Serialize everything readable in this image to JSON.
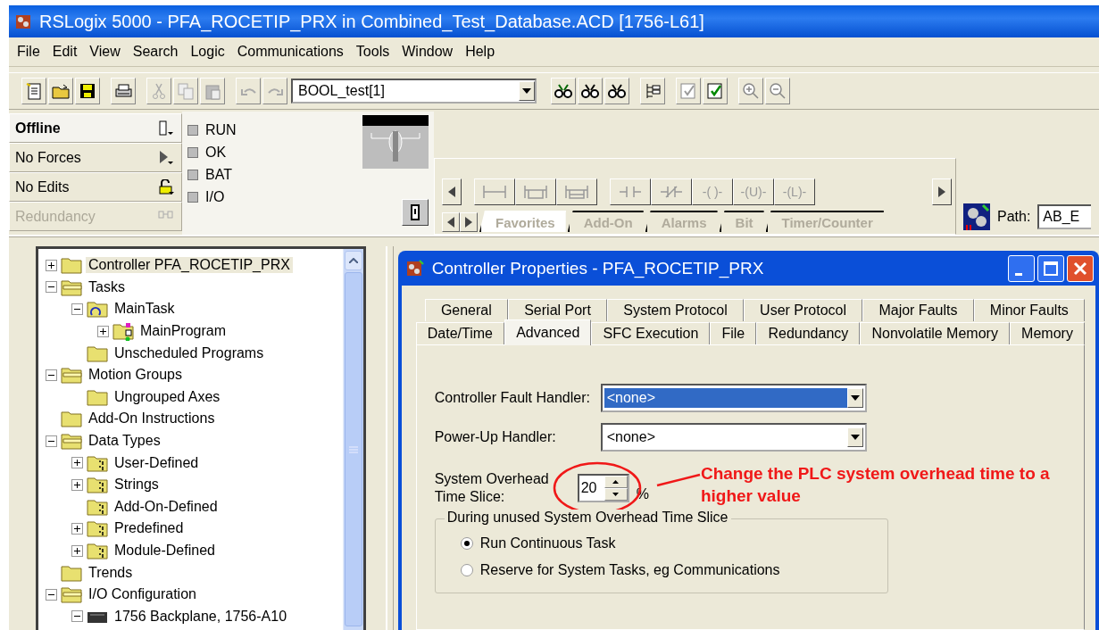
{
  "window": {
    "title": "RSLogix 5000 - PFA_ROCETIP_PRX in Combined_Test_Database.ACD [1756-L61]"
  },
  "menu": [
    "File",
    "Edit",
    "View",
    "Search",
    "Logic",
    "Communications",
    "Tools",
    "Window",
    "Help"
  ],
  "toolbar": {
    "tag_combo": "BOOL_test[1]"
  },
  "status": [
    {
      "label": "Offline",
      "kind": "mode",
      "disabled": false
    },
    {
      "label": "No Forces",
      "kind": "forces",
      "disabled": false
    },
    {
      "label": "No Edits",
      "kind": "edits",
      "disabled": false
    },
    {
      "label": "Redundancy",
      "kind": "redundancy",
      "disabled": true
    }
  ],
  "leds": [
    {
      "label": "RUN",
      "on": false
    },
    {
      "label": "OK",
      "on": false
    },
    {
      "label": "BAT",
      "on": false
    },
    {
      "label": "I/O",
      "on": false
    }
  ],
  "instruction_buttons": [
    {
      "kind": "rung"
    },
    {
      "kind": "branch"
    },
    {
      "kind": "branch-level"
    },
    {
      "kind": "xic"
    },
    {
      "kind": "xio"
    },
    {
      "kind": "text",
      "label": "-( )-"
    },
    {
      "kind": "text",
      "label": "-(U)-"
    },
    {
      "kind": "text",
      "label": "-(L)-"
    }
  ],
  "palette_tabs": [
    {
      "label": "Favorites",
      "selected": true
    },
    {
      "label": "Add-On",
      "selected": false
    },
    {
      "label": "Alarms",
      "selected": false
    },
    {
      "label": "Bit",
      "selected": false
    },
    {
      "label": "Timer/Counter",
      "selected": false
    }
  ],
  "path": {
    "label": "Path:",
    "value": "AB_E"
  },
  "tree": [
    {
      "label": "Controller PFA_ROCETIP_PRX",
      "kind": "folder",
      "expanded": false,
      "selected": true
    },
    {
      "label": "Tasks",
      "kind": "folder-open",
      "expanded": true,
      "selected": false,
      "children": [
        {
          "label": "MainTask",
          "kind": "task",
          "expanded": true,
          "selected": false,
          "children": [
            {
              "label": "MainProgram",
              "kind": "program",
              "expanded": false,
              "selected": false
            }
          ]
        },
        {
          "label": "Unscheduled Programs",
          "kind": "folder",
          "selected": false
        }
      ]
    },
    {
      "label": "Motion Groups",
      "kind": "folder-open",
      "expanded": true,
      "selected": false,
      "children": [
        {
          "label": "Ungrouped Axes",
          "kind": "folder",
          "selected": false
        }
      ]
    },
    {
      "label": "Add-On Instructions",
      "kind": "folder",
      "selected": false
    },
    {
      "label": "Data Types",
      "kind": "folder-open",
      "expanded": true,
      "selected": false,
      "children": [
        {
          "label": "User-Defined",
          "kind": "datatype",
          "expanded": false,
          "selected": false
        },
        {
          "label": "Strings",
          "kind": "datatype",
          "expanded": false,
          "selected": false
        },
        {
          "label": "Add-On-Defined",
          "kind": "datatype",
          "selected": false
        },
        {
          "label": "Predefined",
          "kind": "datatype",
          "expanded": false,
          "selected": false
        },
        {
          "label": "Module-Defined",
          "kind": "datatype",
          "expanded": false,
          "selected": false
        }
      ]
    },
    {
      "label": "Trends",
      "kind": "folder",
      "selected": false
    },
    {
      "label": "I/O Configuration",
      "kind": "folder-open",
      "expanded": true,
      "selected": false,
      "children": [
        {
          "label": "1756 Backplane, 1756-A10",
          "kind": "module",
          "expanded": true,
          "selected": false
        }
      ]
    }
  ],
  "dialog": {
    "title": "Controller Properties - PFA_ROCETIP_PRX",
    "tab_rows": [
      [
        {
          "label": "General",
          "selected": false
        },
        {
          "label": "Serial Port",
          "selected": false
        },
        {
          "label": "System Protocol",
          "selected": false
        },
        {
          "label": "User Protocol",
          "selected": false
        },
        {
          "label": "Major Faults",
          "selected": false
        },
        {
          "label": "Minor Faults",
          "selected": false
        }
      ],
      [
        {
          "label": "Date/Time",
          "selected": false
        },
        {
          "label": "Advanced",
          "selected": true
        },
        {
          "label": "SFC Execution",
          "selected": false
        },
        {
          "label": "File",
          "selected": false
        },
        {
          "label": "Redundancy",
          "selected": false
        },
        {
          "label": "Nonvolatile Memory",
          "selected": false
        },
        {
          "label": "Memory",
          "selected": false
        }
      ]
    ],
    "fault_handler": {
      "label": "Controller Fault Handler:",
      "value": "<none>",
      "focused": true
    },
    "power_up_handler": {
      "label": "Power-Up Handler:",
      "value": "<none>",
      "focused": false
    },
    "overhead": {
      "label": "System Overhead Time Slice:",
      "value": "20",
      "unit": "%"
    },
    "unused_group": {
      "legend": "During unused System Overhead Time Slice",
      "options": [
        {
          "label": "Run Continuous Task",
          "selected": true
        },
        {
          "label": "Reserve for System Tasks, eg Communications",
          "selected": false
        }
      ]
    }
  },
  "annotation": {
    "text": "Change the PLC system overhead time to a higher value"
  }
}
